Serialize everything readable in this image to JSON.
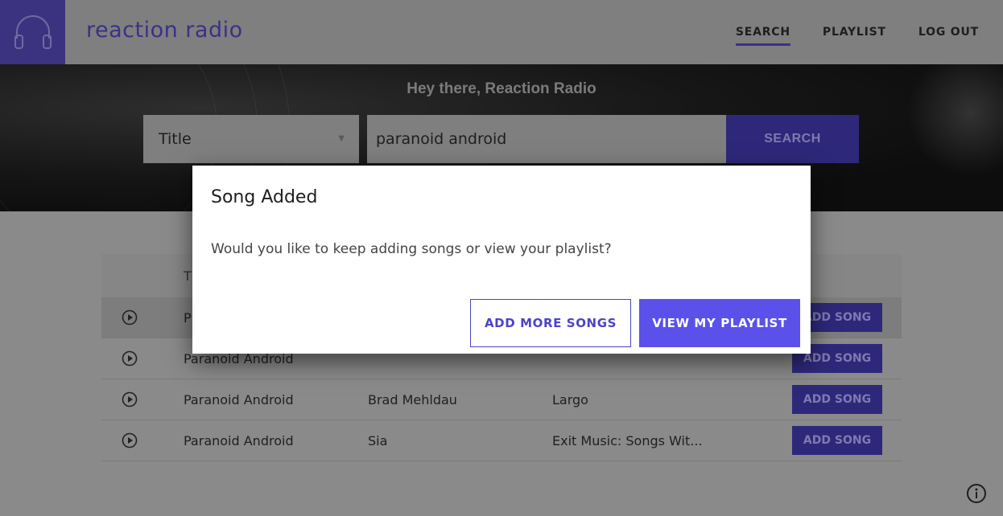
{
  "header": {
    "brand": "reaction radio",
    "logo_icon": "headphones-icon",
    "nav": [
      {
        "label": "SEARCH",
        "active": true
      },
      {
        "label": "PLAYLIST",
        "active": false
      },
      {
        "label": "LOG OUT",
        "active": false
      }
    ]
  },
  "hero": {
    "greeting": "Hey there, Reaction Radio",
    "search_field": "Title",
    "search_value": "paranoid android",
    "search_button": "SEARCH"
  },
  "results": {
    "header_partial": "T",
    "rows": [
      {
        "title": "P",
        "artist": "",
        "album": "",
        "action": "ADD SONG"
      },
      {
        "title": "Paranoid Android",
        "artist": "",
        "album": "",
        "action": "ADD SONG"
      },
      {
        "title": "Paranoid Android",
        "artist": "Brad Mehldau",
        "album": "Largo",
        "action": "ADD SONG"
      },
      {
        "title": "Paranoid Android",
        "artist": "Sia",
        "album": "Exit Music: Songs Wit...",
        "action": "ADD SONG"
      }
    ]
  },
  "modal": {
    "title": "Song Added",
    "body": "Would you like to keep adding songs or view your playlist?",
    "secondary_button": "ADD MORE SONGS",
    "primary_button": "VIEW MY PLAYLIST"
  },
  "colors": {
    "brand": "#5b50ea",
    "overlay": "rgba(0,0,0,0.45)"
  }
}
